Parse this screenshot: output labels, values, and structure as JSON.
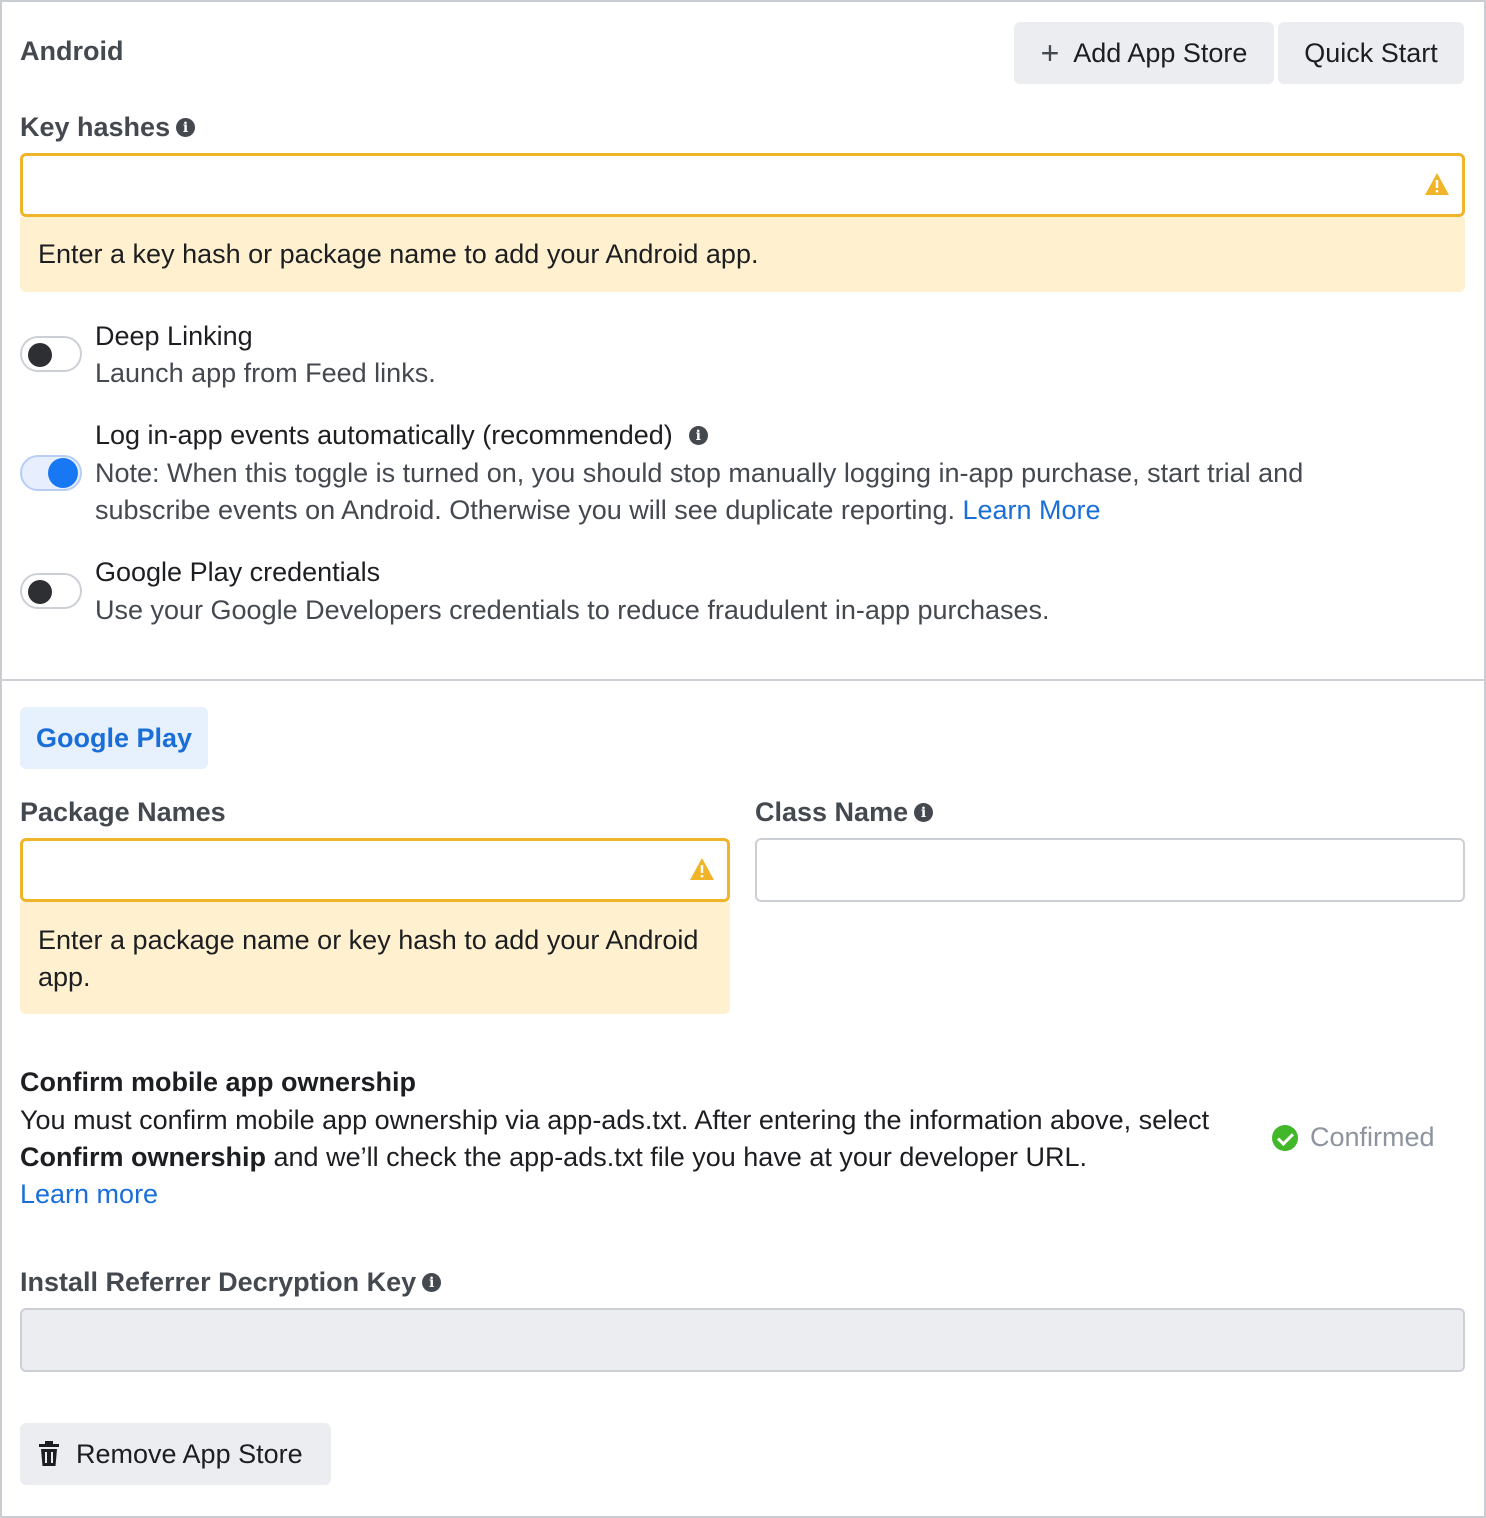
{
  "section": {
    "title": "Android"
  },
  "header_buttons": {
    "add_app_store": "Add App Store",
    "quick_start": "Quick Start"
  },
  "key_hashes": {
    "label": "Key hashes",
    "value": "",
    "warning": "Enter a key hash or package name to add your Android app."
  },
  "toggles": {
    "deep_linking": {
      "title": "Deep Linking",
      "desc": "Launch app from Feed links.",
      "state": "off"
    },
    "log_events": {
      "title": "Log in-app events automatically (recommended)",
      "desc": "Note: When this toggle is turned on, you should stop manually logging in-app purchase, start trial and subscribe events on Android. Otherwise you will see duplicate reporting.",
      "link": "Learn More",
      "state": "on"
    },
    "google_play_credentials": {
      "title": "Google Play credentials",
      "desc": "Use your Google Developers credentials to reduce fraudulent in-app purchases.",
      "state": "off"
    }
  },
  "store_tab": {
    "label": "Google Play"
  },
  "package_names": {
    "label": "Package Names",
    "value": "",
    "warning": "Enter a package name or key hash to add your Android app."
  },
  "class_name": {
    "label": "Class Name",
    "value": ""
  },
  "ownership": {
    "title": "Confirm mobile app ownership",
    "text_before": "You must confirm mobile app ownership via app-ads.txt. After entering the information above, select ",
    "text_bold": "Confirm ownership",
    "text_after": " and we’ll check the app-ads.txt file you have at your developer URL.",
    "link": "Learn more",
    "status": "Confirmed"
  },
  "install_referrer": {
    "label": "Install Referrer Decryption Key",
    "value": ""
  },
  "remove_button": {
    "label": "Remove App Store"
  },
  "colors": {
    "warning_border": "#f0b429",
    "warning_bg": "#fff1cf",
    "link": "#1a6ed8",
    "toggle_on": "#1877f2",
    "confirmed": "#42b72a"
  }
}
